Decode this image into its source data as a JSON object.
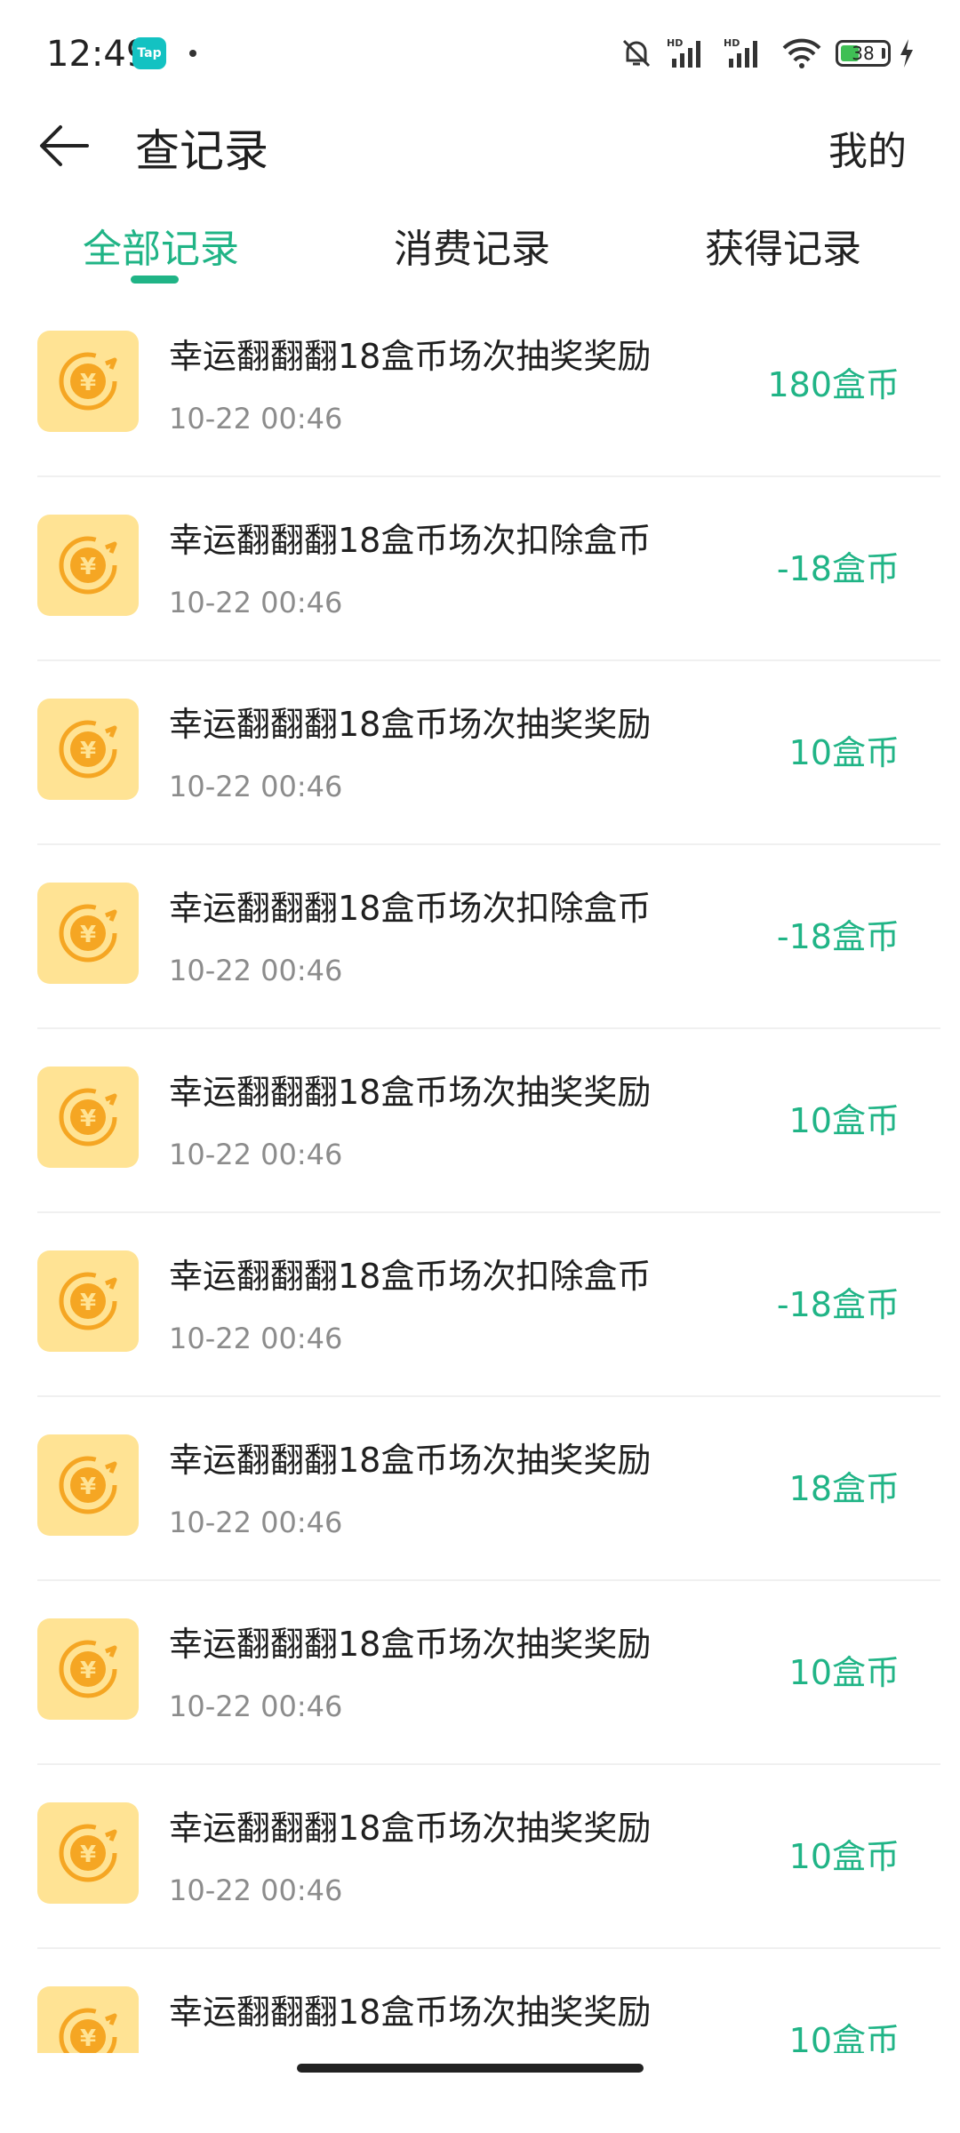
{
  "status_bar": {
    "time": "12:49",
    "tap_badge": "Tap",
    "battery": "38"
  },
  "header": {
    "title": "查记录",
    "right_link": "我的"
  },
  "tabs": [
    {
      "label": "全部记录",
      "active": true
    },
    {
      "label": "消费记录",
      "active": false
    },
    {
      "label": "获得记录",
      "active": false
    }
  ],
  "colors": {
    "accent": "#20b486",
    "icon_bg": "#ffe394",
    "coin": "#f5a623"
  },
  "records": [
    {
      "title": "幸运翻翻翻18盒币场次抽奖奖励",
      "time": "10-22 00:46",
      "amount": "180盒币"
    },
    {
      "title": "幸运翻翻翻18盒币场次扣除盒币",
      "time": "10-22 00:46",
      "amount": "-18盒币"
    },
    {
      "title": "幸运翻翻翻18盒币场次抽奖奖励",
      "time": "10-22 00:46",
      "amount": "10盒币"
    },
    {
      "title": "幸运翻翻翻18盒币场次扣除盒币",
      "time": "10-22 00:46",
      "amount": "-18盒币"
    },
    {
      "title": "幸运翻翻翻18盒币场次抽奖奖励",
      "time": "10-22 00:46",
      "amount": "10盒币"
    },
    {
      "title": "幸运翻翻翻18盒币场次扣除盒币",
      "time": "10-22 00:46",
      "amount": "-18盒币"
    },
    {
      "title": "幸运翻翻翻18盒币场次抽奖奖励",
      "time": "10-22 00:46",
      "amount": "18盒币"
    },
    {
      "title": "幸运翻翻翻18盒币场次抽奖奖励",
      "time": "10-22 00:46",
      "amount": "10盒币"
    },
    {
      "title": "幸运翻翻翻18盒币场次抽奖奖励",
      "time": "10-22 00:46",
      "amount": "10盒币"
    },
    {
      "title": "幸运翻翻翻18盒币场次抽奖奖励",
      "time": "",
      "amount": "10盒币"
    }
  ]
}
